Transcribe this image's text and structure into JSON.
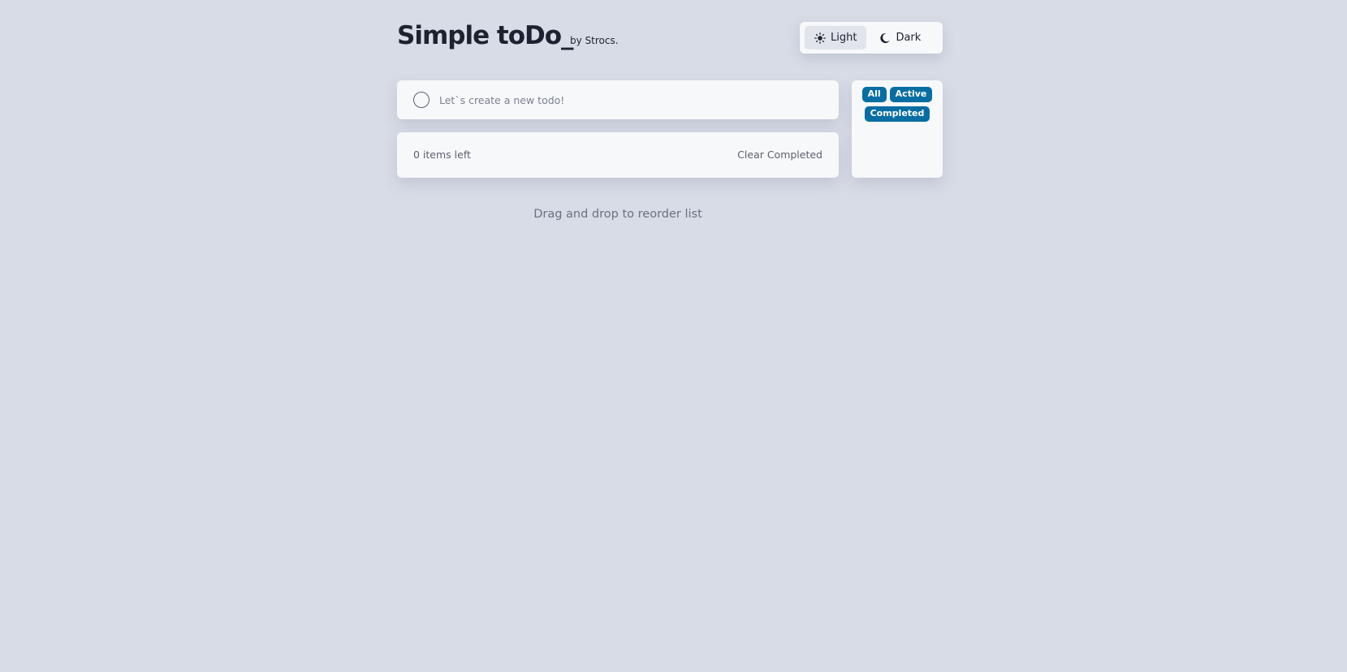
{
  "header": {
    "title": "Simple toDo_",
    "byline": "by Strocs."
  },
  "theme": {
    "options": [
      {
        "label": "Light",
        "icon": "sun-icon",
        "active": true
      },
      {
        "label": "Dark",
        "icon": "moon-icon",
        "active": false
      }
    ]
  },
  "new_todo": {
    "placeholder": "Let`s create a new todo!",
    "value": ""
  },
  "footer": {
    "items_left": "0 items left",
    "clear_label": "Clear Completed"
  },
  "filters": {
    "all": "All",
    "active": "Active",
    "completed": "Completed"
  },
  "hint": "Drag and drop to reorder list",
  "colors": {
    "background": "#d8dce6",
    "card": "#f7f8fa",
    "accent": "#076ea3",
    "text": "#1d2230"
  }
}
